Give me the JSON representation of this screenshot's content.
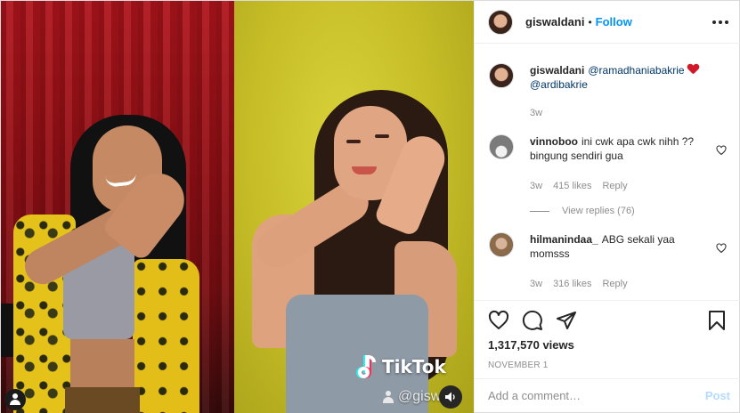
{
  "header": {
    "username": "giswaldani",
    "separator": "•",
    "follow_label": "Follow"
  },
  "media": {
    "watermark": "TikTok",
    "watermark_handle": "@gisw"
  },
  "caption": {
    "username": "giswaldani",
    "mention1": "@ramadhaniabakrie",
    "mention2": "@ardibakrie",
    "time": "3w"
  },
  "comments": [
    {
      "username": "vinnoboo",
      "text": "ini cwk apa cwk nihh ?? bingung sendiri gua",
      "time": "3w",
      "likes": "415 likes",
      "reply_label": "Reply",
      "view_replies": "View replies (76)"
    },
    {
      "username": "hilmanindaa_",
      "text": "ABG sekali yaa momsss",
      "time": "3w",
      "likes": "316 likes",
      "reply_label": "Reply"
    }
  ],
  "stats": {
    "views": "1,317,570 views",
    "date": "NOVEMBER 1"
  },
  "composer": {
    "placeholder": "Add a comment…",
    "post_label": "Post"
  },
  "colors": {
    "accent": "#0095f6",
    "text": "#262626",
    "muted": "#8e8e8e",
    "post_disabled": "#b3dbff",
    "heart": "#d01a2a"
  },
  "icons": [
    "heart-icon",
    "comment-icon",
    "share-icon",
    "bookmark-icon",
    "more-icon",
    "tag-user-icon",
    "speaker-icon",
    "tiktok-logo-icon"
  ]
}
